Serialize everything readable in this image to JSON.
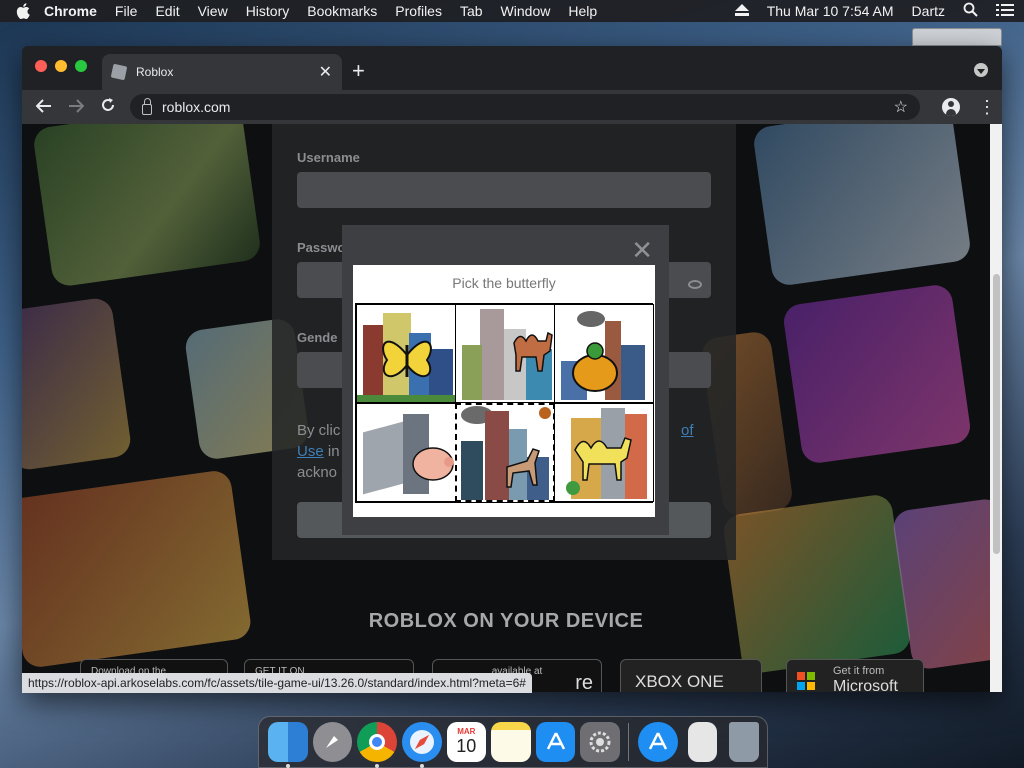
{
  "menubar": {
    "app": "Chrome",
    "items": [
      "File",
      "Edit",
      "View",
      "History",
      "Bookmarks",
      "Profiles",
      "Tab",
      "Window",
      "Help"
    ],
    "clock": "Thu Mar 10  7:54 AM",
    "user": "Dartz"
  },
  "browser": {
    "tab_title": "Roblox",
    "url": "roblox.com",
    "status_url": "https://roblox-api.arkoselabs.com/fc/assets/tile-game-ui/13.26.0/standard/index.html?meta=6#"
  },
  "signup": {
    "username_label": "Username",
    "username_value": "",
    "password_label": "Passwo",
    "gender_label": "Gende",
    "terms_part1": "By clic",
    "terms_link_right": "of",
    "terms_link_use": "Use",
    "terms_part2": "in",
    "terms_part3": "ackno"
  },
  "captcha": {
    "prompt": "Pick the butterfly",
    "tiles": [
      {
        "label": "butterfly",
        "selected": false
      },
      {
        "label": "camel",
        "selected": false
      },
      {
        "label": "turtle",
        "selected": false
      },
      {
        "label": "pig",
        "selected": false
      },
      {
        "label": "deer",
        "selected": true
      },
      {
        "label": "camel",
        "selected": false
      }
    ]
  },
  "device_section": {
    "title": "ROBLOX ON YOUR DEVICE",
    "stores": [
      {
        "line1": "Download on the",
        "line2": ""
      },
      {
        "line1": "GET IT ON",
        "line2": ""
      },
      {
        "line1": "available at",
        "line2": "re"
      },
      {
        "line1": "",
        "line2": "XBOX ONE"
      },
      {
        "line1": "Get it from",
        "line2": "Microsoft"
      }
    ]
  },
  "dock": {
    "apps": [
      "Finder",
      "Launchpad",
      "Chrome",
      "Safari",
      "Calendar",
      "Notes",
      "App Store",
      "System Preferences",
      "App Store",
      "File",
      "Trash"
    ],
    "calendar_month": "MAR",
    "calendar_day": "10"
  },
  "colors": {
    "menubar": "#1e1e22",
    "chrome_frame": "#202124",
    "chrome_toolbar": "#35363a",
    "modal": "#3d3f42",
    "terms_link": "#3f7fb5"
  }
}
